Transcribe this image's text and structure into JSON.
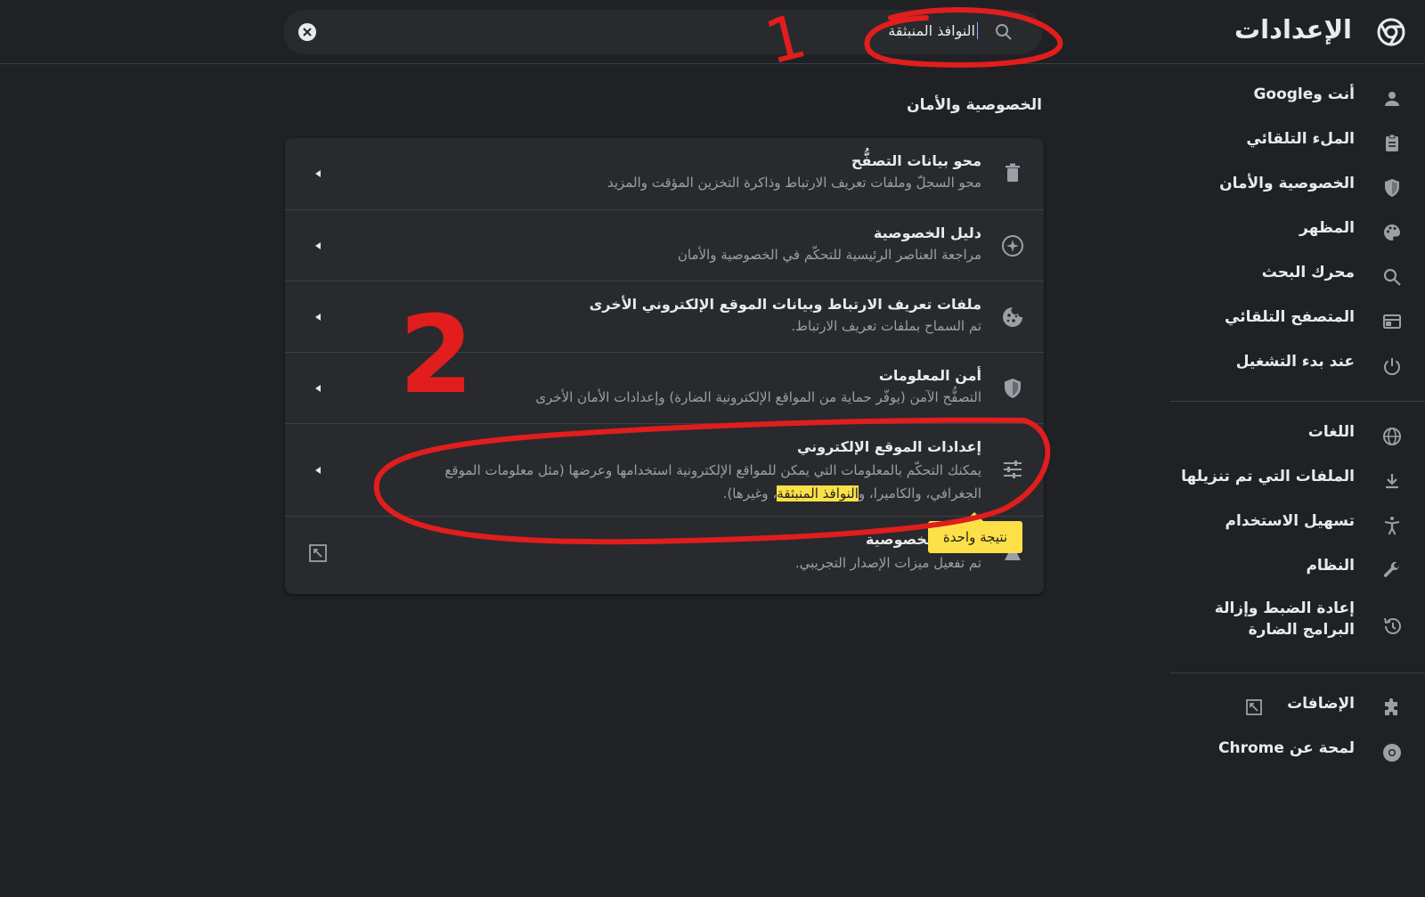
{
  "header": {
    "app_title": "الإعدادات",
    "search": {
      "value": "النوافذ المنبثقة",
      "icon": "search-icon",
      "clear_icon": "close-circle-icon"
    }
  },
  "sidebar": {
    "items": [
      {
        "label": "أنت وGoogle",
        "icon": "person-icon"
      },
      {
        "label": "الملء التلقائي",
        "icon": "clipboard-icon"
      },
      {
        "label": "الخصوصية والأمان",
        "icon": "shield-icon"
      },
      {
        "label": "المظهر",
        "icon": "palette-icon"
      },
      {
        "label": "محرك البحث",
        "icon": "search-icon"
      },
      {
        "label": "المتصفح التلقائي",
        "icon": "browser-icon"
      },
      {
        "label": "عند بدء التشغيل",
        "icon": "power-icon"
      },
      {
        "label": "اللغات",
        "icon": "globe-icon"
      },
      {
        "label": "الملفات التي تم تنزيلها",
        "icon": "download-icon"
      },
      {
        "label": "تسهيل الاستخدام",
        "icon": "accessibility-icon"
      },
      {
        "label": "النظام",
        "icon": "wrench-icon"
      },
      {
        "label": "إعادة الضبط وإزالة البرامج الضارة",
        "icon": "restore-icon"
      },
      {
        "label": "الإضافات",
        "icon": "puzzle-icon"
      },
      {
        "label": "لمحة عن Chrome",
        "icon": "chrome-icon"
      }
    ]
  },
  "main": {
    "section_title": "الخصوصية والأمان",
    "rows": [
      {
        "title": "محو بيانات التصفُّح",
        "subtitle": "محو السجلّ وملفات تعريف الارتباط وذاكرة التخزين المؤقت والمزيد",
        "icon": "trash-icon"
      },
      {
        "title": "دليل الخصوصية",
        "subtitle": "مراجعة العناصر الرئيسية للتحكّم في الخصوصية والأمان",
        "icon": "compass-icon"
      },
      {
        "title": "ملفات تعريف الارتباط وبيانات الموقع الإلكتروني الأخرى",
        "subtitle": "تم السماح بملفات تعريف الارتباط.",
        "icon": "cookie-icon"
      },
      {
        "title": "أمن المعلومات",
        "subtitle": "التصفُّح الآمن (يوفّر حماية من المواقع الإلكترونية الضارة) وإعدادات الأمان الأخرى",
        "icon": "shield-icon"
      },
      {
        "title": "إعدادات الموقع الإلكتروني",
        "subtitle_before": "يمكنك التحكّم بالمعلومات التي يمكن للمواقع الإلكترونية استخدامها وعرضها (مثل معلومات الموقع الجغرافي، والكاميرا، و",
        "subtitle_highlight": "النوافذ المنبثقة",
        "subtitle_after": "، وغيرها).",
        "icon": "tune-icon"
      },
      {
        "title": "حماية الخصوصية",
        "subtitle": "تم تفعيل ميزات الإصدار التجريبي.",
        "icon": "flask-icon"
      }
    ],
    "tooltip": "نتيجة واحدة"
  },
  "annotations": {
    "labels": [
      "1",
      "2"
    ],
    "color": "#e11d1d"
  },
  "colors": {
    "background": "#202124",
    "card": "#292a2d",
    "text": "#e8eaed",
    "secondary_text": "#9aa0a6",
    "highlight": "#fde047",
    "accent": "#8ab4f8"
  }
}
